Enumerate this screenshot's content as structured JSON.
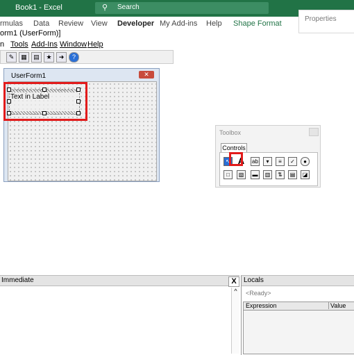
{
  "excel": {
    "title": "Book1  -  Excel",
    "search_placeholder": "Search",
    "properties_pane": "Properties",
    "ribbon_tabs": [
      "rmulas",
      "Data",
      "Review",
      "View",
      "Developer",
      "My Add-ins",
      "Help",
      "Shape Format"
    ]
  },
  "vbe": {
    "caption": "orm1 (UserForm)]",
    "menu": [
      "n",
      "Tools",
      "Add-Ins",
      "Window",
      "Help"
    ]
  },
  "userform": {
    "title": "UserForm1",
    "close_glyph": "✕",
    "label_text": "Text in Label"
  },
  "toolbox": {
    "title": "Toolbox",
    "tab": "Controls",
    "label_control_glyph": "A"
  },
  "immediate": {
    "title": "Immediate",
    "close_glyph": "X",
    "scroll_up_glyph": "^"
  },
  "locals": {
    "title": "Locals",
    "status": "<Ready>",
    "columns": [
      "Expression",
      "Value"
    ]
  },
  "colors": {
    "excel_green": "#217346",
    "highlight_red": "#e21b1b"
  }
}
